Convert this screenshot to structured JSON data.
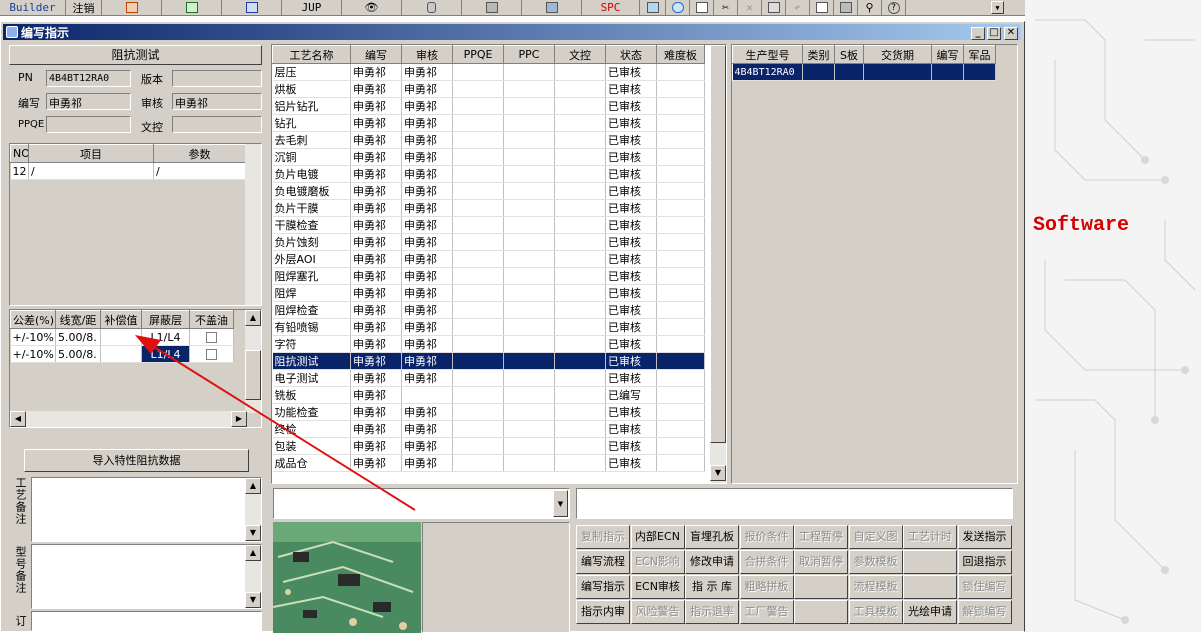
{
  "toolbar": {
    "builder": "Builder",
    "logout": "注销",
    "jup": "JUP",
    "spc": "SPC",
    "icons": [
      "access-icon",
      "excel-icon",
      "word-icon",
      "jup-icon",
      "eye-icon",
      "database-icon",
      "network-icon",
      "monitor-icon",
      "spc-icon",
      "tree-icon",
      "ie-icon",
      "new-icon",
      "cut-icon",
      "close-icon",
      "save-icon",
      "undo-icon",
      "preview-icon",
      "print-icon",
      "find-icon",
      "help-icon"
    ]
  },
  "brand_text": "er Software",
  "window": {
    "title": "编写指示",
    "minimize": "_",
    "restore": "□",
    "close": "✕"
  },
  "left": {
    "header": "阻抗测试",
    "pn_label": "PN",
    "pn_value": "4B4BT12RA0",
    "version_label": "版本",
    "version_value": "",
    "writer_label": "编写",
    "writer_value": "申勇祁",
    "review_label": "审核",
    "review_value": "申勇祁",
    "ppqe_label": "PPQE",
    "ppqe_value": "",
    "doc_label": "文控",
    "doc_value": "",
    "items_cols": [
      "NO",
      "项目",
      "参数"
    ],
    "items_rows": [
      [
        "12",
        "/",
        "/"
      ]
    ],
    "imp_cols": [
      "公差(%)",
      "线宽/距",
      "补偿值",
      "屏蔽层",
      "不盖油"
    ],
    "imp_rows": [
      [
        "+/-10%",
        "5.00/8.",
        "",
        "L1/L4",
        ""
      ],
      [
        "+/-10%",
        "5.00/8.",
        "",
        "L1/L4",
        ""
      ]
    ],
    "import_button": "导入特性阻抗数据",
    "remark1": "工艺备注",
    "remark2": "型号备注",
    "remark3": "订单备注"
  },
  "process": {
    "cols": [
      "工艺名称",
      "编写",
      "审核",
      "PPQE",
      "PPC",
      "文控",
      "状态",
      "难度板"
    ],
    "rows": [
      [
        "层压",
        "申勇祁",
        "申勇祁",
        "",
        "",
        "",
        "已审核",
        ""
      ],
      [
        "烘板",
        "申勇祁",
        "申勇祁",
        "",
        "",
        "",
        "已审核",
        ""
      ],
      [
        "铝片钻孔",
        "申勇祁",
        "申勇祁",
        "",
        "",
        "",
        "已审核",
        ""
      ],
      [
        "钻孔",
        "申勇祁",
        "申勇祁",
        "",
        "",
        "",
        "已审核",
        ""
      ],
      [
        "去毛刺",
        "申勇祁",
        "申勇祁",
        "",
        "",
        "",
        "已审核",
        ""
      ],
      [
        "沉铜",
        "申勇祁",
        "申勇祁",
        "",
        "",
        "",
        "已审核",
        ""
      ],
      [
        "负片电镀",
        "申勇祁",
        "申勇祁",
        "",
        "",
        "",
        "已审核",
        ""
      ],
      [
        "负电镀磨板",
        "申勇祁",
        "申勇祁",
        "",
        "",
        "",
        "已审核",
        ""
      ],
      [
        "负片干膜",
        "申勇祁",
        "申勇祁",
        "",
        "",
        "",
        "已审核",
        ""
      ],
      [
        "干膜检查",
        "申勇祁",
        "申勇祁",
        "",
        "",
        "",
        "已审核",
        ""
      ],
      [
        "负片蚀刻",
        "申勇祁",
        "申勇祁",
        "",
        "",
        "",
        "已审核",
        ""
      ],
      [
        "外层AOI",
        "申勇祁",
        "申勇祁",
        "",
        "",
        "",
        "已审核",
        ""
      ],
      [
        "阻焊塞孔",
        "申勇祁",
        "申勇祁",
        "",
        "",
        "",
        "已审核",
        ""
      ],
      [
        "阻焊",
        "申勇祁",
        "申勇祁",
        "",
        "",
        "",
        "已审核",
        ""
      ],
      [
        "阻焊检查",
        "申勇祁",
        "申勇祁",
        "",
        "",
        "",
        "已审核",
        ""
      ],
      [
        "有铅喷锡",
        "申勇祁",
        "申勇祁",
        "",
        "",
        "",
        "已审核",
        ""
      ],
      [
        "字符",
        "申勇祁",
        "申勇祁",
        "",
        "",
        "",
        "已审核",
        ""
      ],
      [
        "阻抗测试",
        "申勇祁",
        "申勇祁",
        "",
        "",
        "",
        "已审核",
        ""
      ],
      [
        "电子测试",
        "申勇祁",
        "申勇祁",
        "",
        "",
        "",
        "已审核",
        ""
      ],
      [
        "铣板",
        "申勇祁",
        "",
        "",
        "",
        "",
        "已编写",
        ""
      ],
      [
        "功能检查",
        "申勇祁",
        "申勇祁",
        "",
        "",
        "",
        "已审核",
        ""
      ],
      [
        "终检",
        "申勇祁",
        "申勇祁",
        "",
        "",
        "",
        "已审核",
        ""
      ],
      [
        "包装",
        "申勇祁",
        "申勇祁",
        "",
        "",
        "",
        "已审核",
        ""
      ],
      [
        "成品仓",
        "申勇祁",
        "申勇祁",
        "",
        "",
        "",
        "已审核",
        ""
      ]
    ],
    "selected_index": 17
  },
  "products": {
    "cols": [
      "生产型号",
      "类别",
      "S板",
      "交货期",
      "编写",
      "军品"
    ],
    "rows": [
      [
        "4B4BT12RA0",
        "",
        "",
        "",
        "",
        ""
      ]
    ]
  },
  "actions": [
    [
      "复制指示",
      "内部ECN",
      "盲埋孔板",
      "报价条件",
      "工程暂停",
      "自定义图",
      "工艺计时",
      "发送指示"
    ],
    [
      "编写流程",
      "ECN影响",
      "修改申请",
      "合拼条件",
      "取消暂停",
      "参数模板",
      "",
      "回退指示"
    ],
    [
      "编写指示",
      "ECN审核",
      "指 示 库",
      "粗略拼板",
      "",
      "流程模板",
      "",
      "锁住编写"
    ],
    [
      "指示内审",
      "风险警告",
      "指示退率",
      "工厂警告",
      "",
      "工具模板",
      "光绘申请",
      "解锁编写"
    ]
  ],
  "actions_enabled": [
    [
      false,
      true,
      true,
      false,
      false,
      false,
      false,
      true
    ],
    [
      true,
      false,
      true,
      false,
      false,
      false,
      false,
      true
    ],
    [
      true,
      true,
      true,
      false,
      false,
      false,
      false,
      false
    ],
    [
      true,
      false,
      false,
      false,
      false,
      false,
      true,
      false
    ]
  ],
  "colors": {
    "selection": "#0a246a",
    "arrow": "#e01010",
    "brand": "#d40000"
  }
}
